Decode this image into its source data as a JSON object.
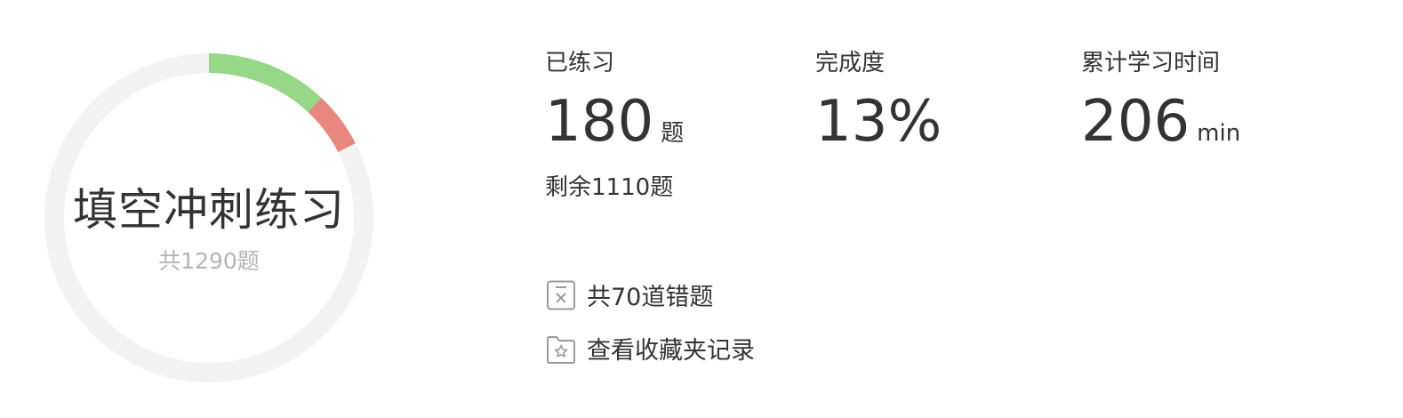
{
  "ring": {
    "title": "填空冲刺练习",
    "subtitle": "共1290题",
    "track_color": "#f2f2f2",
    "segments": [
      {
        "name": "correct",
        "fraction": 0.12,
        "color": "#96d788"
      },
      {
        "name": "wrong",
        "fraction": 0.055,
        "color": "#e88680"
      }
    ]
  },
  "stats": {
    "practiced": {
      "label": "已练习",
      "value": "180",
      "unit": "题"
    },
    "completion": {
      "label": "完成度",
      "value": "13%"
    },
    "study_time": {
      "label": "累计学习时间",
      "value": "206",
      "unit": "min"
    }
  },
  "remaining": "剩余1110题",
  "links": {
    "wrong_questions": {
      "label": "共70道错题",
      "icon": "wrong-questions-icon"
    },
    "favorites": {
      "label": "查看收藏夹记录",
      "icon": "favorites-folder-icon"
    }
  }
}
